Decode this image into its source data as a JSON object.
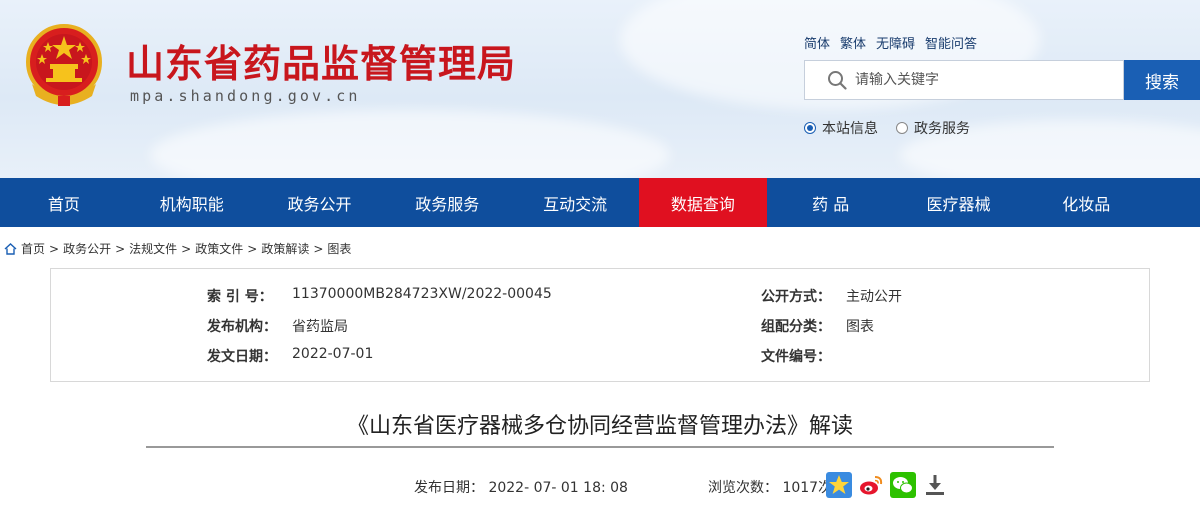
{
  "header": {
    "site_name": "山东省药品监督管理局",
    "site_domain": "mpa.shandong.gov.cn",
    "toplinks": [
      "简体",
      "繁体",
      "无障碍",
      "智能问答"
    ],
    "search_placeholder": "请输入关键字",
    "search_button": "搜索",
    "scope": [
      {
        "label": "本站信息",
        "selected": true
      },
      {
        "label": "政务服务",
        "selected": false
      }
    ]
  },
  "nav": {
    "items": [
      "首页",
      "机构职能",
      "政务公开",
      "政务服务",
      "互动交流",
      "数据查询",
      "药 品",
      "医疗器械",
      "化妆品"
    ],
    "active": "数据查询"
  },
  "breadcrumb": [
    "首页",
    "政务公开",
    "法规文件",
    "政策文件",
    "政策解读",
    "图表"
  ],
  "info": {
    "index_label": "索 引 号：",
    "index_value": "11370000MB284723XW/2022-00045",
    "open_label": "公开方式：",
    "open_value": "主动公开",
    "org_label": "发布机构：",
    "org_value": "省药监局",
    "category_label": "组配分类：",
    "category_value": "图表",
    "date_label": "发文日期：",
    "date_value": "2022-07-01",
    "docno_label": "文件编号：",
    "docno_value": ""
  },
  "article": {
    "title": "《山东省医疗器械多仓协同经营监督管理办法》解读",
    "publish": "发布日期： 2022- 07- 01 18: 08",
    "views": "浏览次数： 1017次"
  },
  "colors": {
    "nav_bg": "#0f4e9d",
    "nav_active": "#e01020",
    "site_name": "#c8161d",
    "search_button": "#1a5fb4"
  },
  "icons": [
    "national-emblem",
    "search-icon",
    "home-icon",
    "favorite-star-icon",
    "weibo-icon",
    "wechat-icon",
    "download-icon"
  ]
}
